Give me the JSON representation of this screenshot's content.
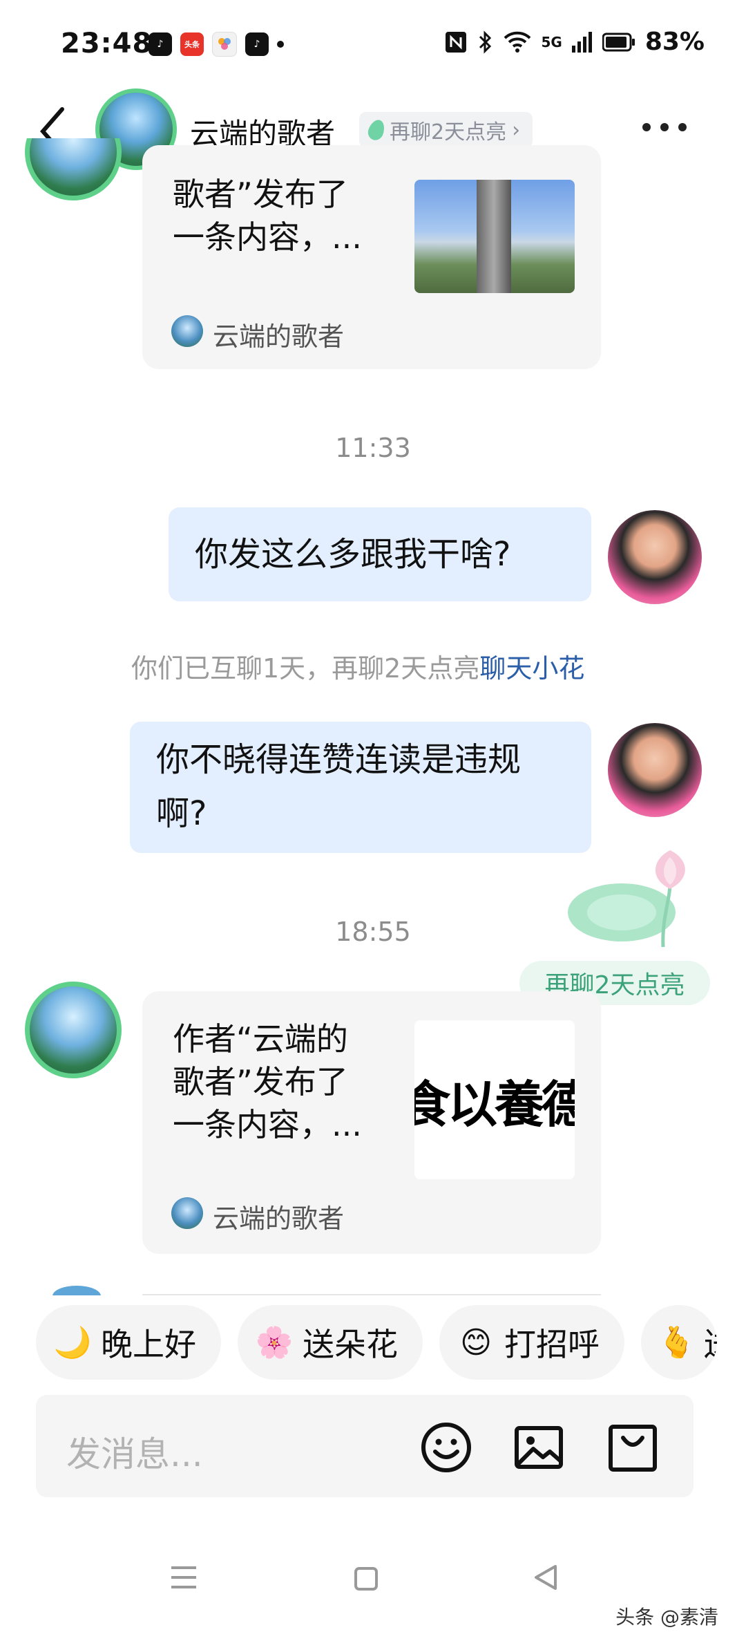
{
  "status_bar": {
    "time": "23:48",
    "app_icons": [
      "tiktok-icon",
      "toutiao-icon",
      "multicolor-app-icon",
      "tiktok-lite-icon"
    ],
    "toutiao_label": "头条",
    "network": "5G",
    "battery": "83%"
  },
  "header": {
    "contact_name": "云端的歌者",
    "streak_label": "再聊2天点亮",
    "streak_arrow": "›"
  },
  "messages": {
    "card_top": {
      "text_line1": "歌者”发布了",
      "text_line2": "一条内容，...",
      "author": "云端的歌者"
    },
    "time1": "11:33",
    "bubble1": "你发这么多跟我干啥?",
    "system_note": "你们已互聊1天，再聊2天点亮",
    "system_link": "聊天小花",
    "bubble2_line1": "你不晓得连赞连读是违规",
    "bubble2_line2": "啊?",
    "streak_pill": "再聊2天点亮",
    "time2": "18:55",
    "card_bottom": {
      "text_line1": "作者“云端的",
      "text_line2": "歌者”发布了",
      "text_line3": "一条内容，...",
      "thumb_text": "食以養德",
      "author": "云端的歌者"
    }
  },
  "quick_replies": [
    {
      "emoji": "🌙",
      "label": "晚上好"
    },
    {
      "emoji": "🌸",
      "label": "送朵花"
    },
    {
      "emoji": "😊",
      "label": "打招呼"
    },
    {
      "emoji": "🫰",
      "label": "送"
    }
  ],
  "input": {
    "placeholder": "发消息..."
  },
  "watermark": "头条 @素清",
  "colors": {
    "bubble_me": "#e3efff",
    "link": "#2a5ea8",
    "streak_green": "#3ba27a"
  }
}
